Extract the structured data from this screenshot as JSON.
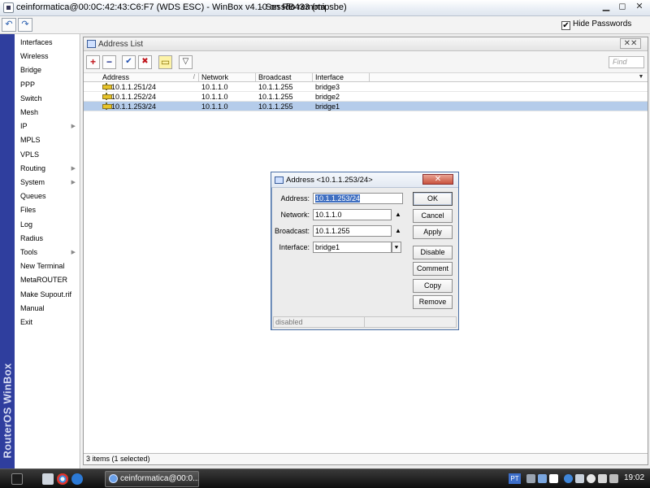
{
  "window": {
    "title": "ceinformatica@00:0C:42:43:C6:F7 (WDS ESC) - WinBox v4.10 on RB433 (mipsbe)",
    "remote_session": "Sessão remota",
    "min_label": "▁",
    "restore_label": "◻",
    "close_label": "✕"
  },
  "toolbar": {
    "undo_label": "↶",
    "redo_label": "↷",
    "hide_passwords_label": "Hide Passwords",
    "hide_passwords_checked": "✔"
  },
  "sidebar": {
    "vertical_title": "RouterOS WinBox",
    "items": [
      {
        "label": "Interfaces",
        "has_submenu": false
      },
      {
        "label": "Wireless",
        "has_submenu": false
      },
      {
        "label": "Bridge",
        "has_submenu": false
      },
      {
        "label": "PPP",
        "has_submenu": false
      },
      {
        "label": "Switch",
        "has_submenu": false
      },
      {
        "label": "Mesh",
        "has_submenu": false
      },
      {
        "label": "IP",
        "has_submenu": true
      },
      {
        "label": "MPLS",
        "has_submenu": false
      },
      {
        "label": "VPLS",
        "has_submenu": false
      },
      {
        "label": "Routing",
        "has_submenu": true
      },
      {
        "label": "System",
        "has_submenu": true
      },
      {
        "label": "Queues",
        "has_submenu": false
      },
      {
        "label": "Files",
        "has_submenu": false
      },
      {
        "label": "Log",
        "has_submenu": false
      },
      {
        "label": "Radius",
        "has_submenu": false
      },
      {
        "label": "Tools",
        "has_submenu": true
      },
      {
        "label": "New Terminal",
        "has_submenu": false
      },
      {
        "label": "MetaROUTER",
        "has_submenu": false
      },
      {
        "label": "Make Supout.rif",
        "has_submenu": false
      },
      {
        "label": "Manual",
        "has_submenu": false
      },
      {
        "label": "Exit",
        "has_submenu": false
      }
    ],
    "submenu_arrow": "▶"
  },
  "address_list": {
    "title": "Address List",
    "close_label": "✕✕",
    "tools": {
      "add": "+",
      "remove": "−",
      "enable": "✔",
      "disable": "✖",
      "comment": "▭",
      "filter": "▽"
    },
    "find_placeholder": "Find",
    "columns": [
      "Address",
      "Network",
      "Broadcast",
      "Interface"
    ],
    "sort_indicator": "/",
    "column_menu": "▼",
    "rows": [
      {
        "address": "10.1.1.251/24",
        "network": "10.1.1.0",
        "broadcast": "10.1.1.255",
        "interface": "bridge3",
        "selected": false
      },
      {
        "address": "10.1.1.252/24",
        "network": "10.1.1.0",
        "broadcast": "10.1.1.255",
        "interface": "bridge2",
        "selected": false
      },
      {
        "address": "10.1.1.253/24",
        "network": "10.1.1.0",
        "broadcast": "10.1.1.255",
        "interface": "bridge1",
        "selected": true
      }
    ],
    "status": "3 items (1 selected)"
  },
  "dialog": {
    "title": "Address <10.1.1.253/24>",
    "close_label": "✕",
    "fields": {
      "address_label": "Address:",
      "address_value": "10.1.1.253/24",
      "network_label": "Network:",
      "network_value": "10.1.1.0",
      "broadcast_label": "Broadcast:",
      "broadcast_value": "10.1.1.255",
      "interface_label": "Interface:",
      "interface_value": "bridge1",
      "up_arrow": "▲",
      "dropdown_arrow": "⯆"
    },
    "buttons": {
      "ok": "OK",
      "cancel": "Cancel",
      "apply": "Apply",
      "disable": "Disable",
      "comment": "Comment",
      "copy": "Copy",
      "remove": "Remove"
    },
    "status": "disabled"
  },
  "taskbar": {
    "task_label": "ceinformatica@00:0...",
    "language": "PT",
    "clock": "19:02"
  },
  "colors": {
    "selection": "#b5ccea",
    "sidebar_band": "#2f3e9e",
    "dialog_close": "#c9523d"
  }
}
